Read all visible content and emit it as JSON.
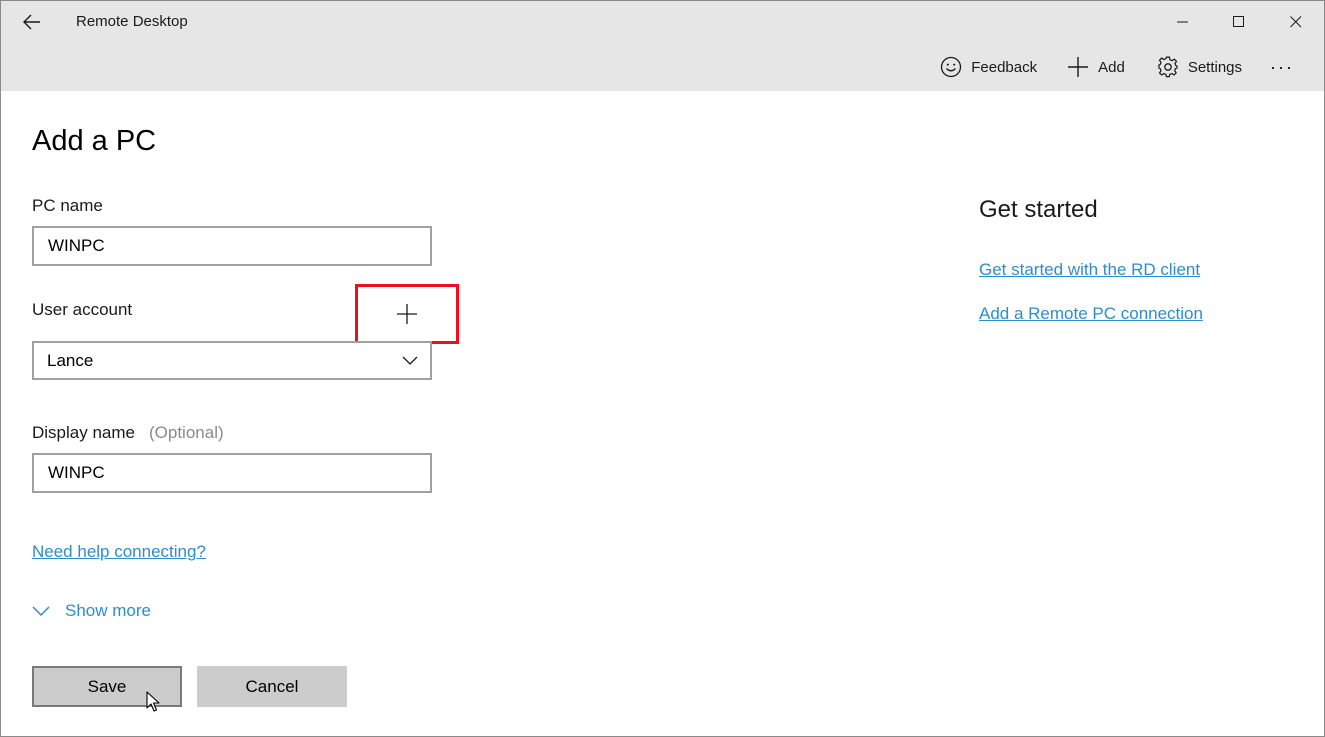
{
  "window": {
    "title": "Remote Desktop"
  },
  "toolbar": {
    "feedback_label": "Feedback",
    "add_label": "Add",
    "settings_label": "Settings",
    "more_label": "···"
  },
  "form": {
    "title": "Add a PC",
    "pc_name": {
      "label": "PC name",
      "value": "WINPC"
    },
    "user_account": {
      "label": "User account",
      "selected": "Lance"
    },
    "display_name": {
      "label": "Display name",
      "optional_hint": "(Optional)",
      "value": "WINPC"
    },
    "help_link": "Need help connecting?",
    "show_more_label": "Show more",
    "save_label": "Save",
    "cancel_label": "Cancel"
  },
  "side_panel": {
    "title": "Get started",
    "links": [
      "Get started with the RD client",
      "Add a Remote PC connection"
    ]
  },
  "colors": {
    "titlebar_bg": "#e6e6e6",
    "link": "#2d8ec8",
    "highlight_box": "#e81123",
    "button_bg": "#cccccc",
    "input_border": "#a0a0a0"
  },
  "icons": {
    "back": "back-arrow-icon",
    "minimize": "minimize-icon",
    "maximize": "maximize-icon",
    "close": "close-icon",
    "feedback": "smiley-icon",
    "add": "plus-icon",
    "settings": "gear-icon",
    "add_account": "plus-icon",
    "combo": "chevron-down-icon",
    "show_more": "chevron-down-icon",
    "cursor": "mouse-pointer-icon"
  }
}
